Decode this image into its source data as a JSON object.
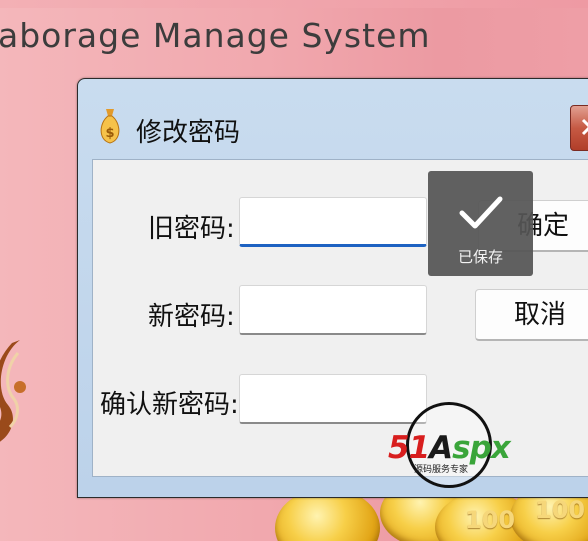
{
  "app": {
    "title": "aborage Manage System"
  },
  "dialog": {
    "title": "修改密码",
    "fields": {
      "old_password_label": "旧密码:",
      "new_password_label": "新密码:",
      "confirm_password_label": "确认新密码:"
    },
    "buttons": {
      "ok": "确定",
      "cancel": "取消"
    }
  },
  "toast": {
    "text": "已保存"
  },
  "watermark": {
    "logo_red": "51",
    "logo_black": "A",
    "logo_green_1": "sp",
    "logo_green_2": "x",
    "tagline": "源码服务专家"
  },
  "decor": {
    "coin_value": "100"
  },
  "colors": {
    "focus_underline": "#1d62c2",
    "toast_bg": "#555555",
    "close_button": "#c65a44"
  },
  "icons": {
    "dialog_icon": "money-bag-icon",
    "close_icon": "close-icon",
    "toast_icon": "check-icon"
  }
}
